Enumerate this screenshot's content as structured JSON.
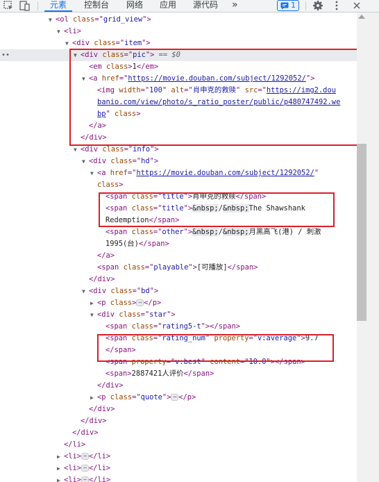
{
  "toolbar": {
    "tabs": [
      "元素",
      "控制台",
      "网络",
      "应用",
      "源代码"
    ],
    "more": "»",
    "issues_count": "1",
    "icons": [
      "inspect-element-icon",
      "device-toolbar-icon",
      "issues-icon",
      "settings-icon",
      "more-vert-icon",
      "close-icon"
    ]
  },
  "selected_suffix": " == $0",
  "lines": {
    "l1": {
      "tag": "ol",
      "attr": "class",
      "val": "grid_view"
    },
    "l2": {
      "tag": "li"
    },
    "l3": {
      "tag": "div",
      "attr": "class",
      "val": "item"
    },
    "l4": {
      "tag": "div",
      "attr": "class",
      "val": "pic"
    },
    "l5": {
      "tag": "em",
      "attr": "class",
      "text": "1"
    },
    "l6": {
      "tag": "a",
      "attr": "href",
      "link": "https://movie.douban.com/subject/1292052/"
    },
    "l7": {
      "tag": "img",
      "attr_width": "width",
      "val_width": "100",
      "attr_alt": "alt",
      "val_alt": "肖申克的救赎",
      "attr_src": "src",
      "link_part1": "https://img2.dou",
      "link_part2": "banio.com/view/photo/s_ratio_poster/public/p480747492.we",
      "link_part3": "bp",
      "attr_class": "class"
    },
    "l10": {
      "tag": "a"
    },
    "l11": {
      "tag": "div"
    },
    "l12": {
      "tag": "div",
      "attr": "class",
      "val": "info"
    },
    "l13": {
      "tag": "div",
      "attr": "class",
      "val": "hd"
    },
    "l14": {
      "tag": "a",
      "attr": "href",
      "link": "https://movie.douban.com/subject/1292052/"
    },
    "l15": {
      "attr": "class"
    },
    "l16": {
      "tag": "span",
      "attr": "class",
      "val": "title",
      "text": "肖申克的救赎"
    },
    "l17": {
      "tag": "span",
      "attr": "class",
      "val": "title",
      "entity": "&nbsp;",
      "slash": "/",
      "text": "The Shawshank"
    },
    "l18": {
      "text": "Redemption",
      "tag": "span"
    },
    "l19": {
      "tag": "span",
      "attr": "class",
      "val": "other",
      "entity": "&nbsp;",
      "slash": "/",
      "text": "月黑高飞(港) / 刺激"
    },
    "l20": {
      "text": "1995(台)",
      "tag": "span"
    },
    "l21": {
      "tag": "a"
    },
    "l22": {
      "tag": "span",
      "attr": "class",
      "val": "playable",
      "text": "[可播放]"
    },
    "l23": {
      "tag": "div"
    },
    "l24": {
      "tag": "div",
      "attr": "class",
      "val": "bd"
    },
    "l25": {
      "tag": "p",
      "attr": "class",
      "ellipsis": "⋯"
    },
    "l26": {
      "tag": "div",
      "attr": "class",
      "val": "star"
    },
    "l27": {
      "tag": "span",
      "attr": "class",
      "val": "rating5-t"
    },
    "l28": {
      "tag": "span",
      "attr": "class",
      "val": "rating_num",
      "attr2": "property",
      "val2": "v:average",
      "text": "9.7"
    },
    "l29": {
      "tag": "span"
    },
    "l30": {
      "tag": "span",
      "attr": "property",
      "val": "v:best",
      "attr2": "content",
      "val2": "10.0"
    },
    "l31": {
      "tag": "span",
      "text": "2887421人评价"
    },
    "l32": {
      "tag": "div"
    },
    "l33": {
      "tag": "p",
      "attr": "class",
      "val": "quote",
      "ellipsis": "⋯"
    },
    "l34": {
      "tag": "div"
    },
    "l35": {
      "tag": "div"
    },
    "l36": {
      "tag": "div"
    },
    "l37": {
      "tag": "li"
    },
    "l38": {
      "tag": "li",
      "ellipsis": "⋯"
    },
    "l39": {
      "tag": "li",
      "ellipsis": "⋯"
    },
    "l40": {
      "tag": "li",
      "ellipsis": "⋯"
    }
  }
}
